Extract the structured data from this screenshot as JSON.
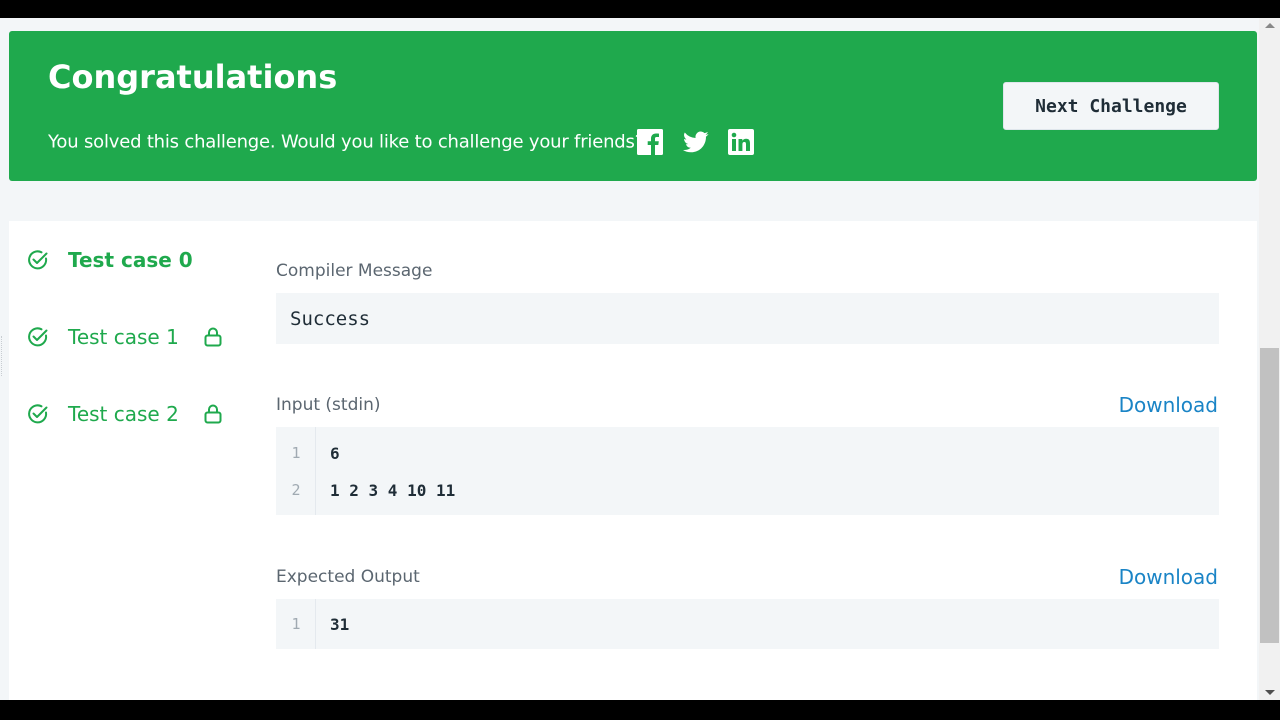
{
  "banner": {
    "title": "Congratulations",
    "subtitle": "You solved this challenge. Would you like to challenge your friends?",
    "share_icons": [
      "facebook-icon",
      "twitter-icon",
      "linkedin-icon"
    ],
    "next_button_label": "Next Challenge",
    "color": "#1fa94d"
  },
  "test_cases": [
    {
      "label": "Test case 0",
      "status": "passed",
      "locked": false,
      "active": true
    },
    {
      "label": "Test case 1",
      "status": "passed",
      "locked": true,
      "active": false
    },
    {
      "label": "Test case 2",
      "status": "passed",
      "locked": true,
      "active": false
    }
  ],
  "compiler": {
    "title": "Compiler Message",
    "message": "Success"
  },
  "input": {
    "title": "Input (stdin)",
    "download_label": "Download",
    "lines": [
      {
        "num": "1",
        "text": "6"
      },
      {
        "num": "2",
        "text": "1 2 3 4 10 11"
      }
    ]
  },
  "expected": {
    "title": "Expected Output",
    "download_label": "Download",
    "lines": [
      {
        "num": "1",
        "text": "31"
      }
    ]
  },
  "colors": {
    "accent": "#1fa94d",
    "link": "#1a84c6",
    "code_bg": "#f3f6f8"
  }
}
